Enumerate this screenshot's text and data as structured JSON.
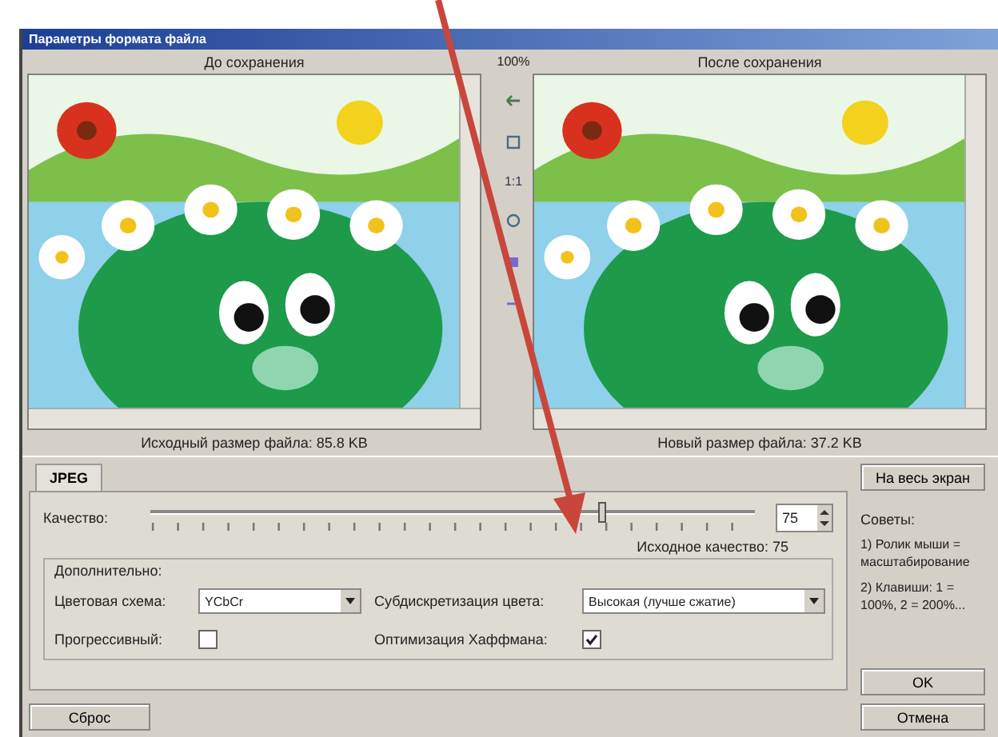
{
  "window": {
    "title": "Параметры формата файла"
  },
  "previews": [
    {
      "heading": "До сохранения",
      "size_label": "Исходный размер файла:  85.8 KB"
    },
    {
      "heading": "После сохранения",
      "size_label": "Новый размер файла:  37.2 KB"
    }
  ],
  "toolbar": {
    "zoom": "100%",
    "actual_size": "1:1"
  },
  "tabs": [
    {
      "label": "JPEG",
      "selected": true
    }
  ],
  "quality": {
    "label": "Качество:",
    "level": 0.75,
    "value": "75",
    "original": "Исходное качество: 75"
  },
  "advanced": {
    "title": "Дополнительно:",
    "options": [
      {
        "kind": "select",
        "label": "Цветовая схема:",
        "value": "YCbCr"
      },
      {
        "kind": "select",
        "label": "Субдискретизация цвета:",
        "value": "Высокая (лучше сжатие)"
      },
      {
        "kind": "checkbox",
        "label": "Прогрессивный:",
        "checked": false
      },
      {
        "kind": "checkbox",
        "label": "Оптимизация Хаффмана:",
        "checked": true
      }
    ]
  },
  "fullscreen_button": "На весь экран",
  "tips": {
    "title": "Советы:",
    "items": [
      "1) Ролик мыши = масштабирование",
      "2) Клавиши: 1 = 100%, 2 = 200%..."
    ]
  },
  "buttons": {
    "ok": "OK",
    "cancel": "Отмена",
    "reset": "Сброс"
  }
}
